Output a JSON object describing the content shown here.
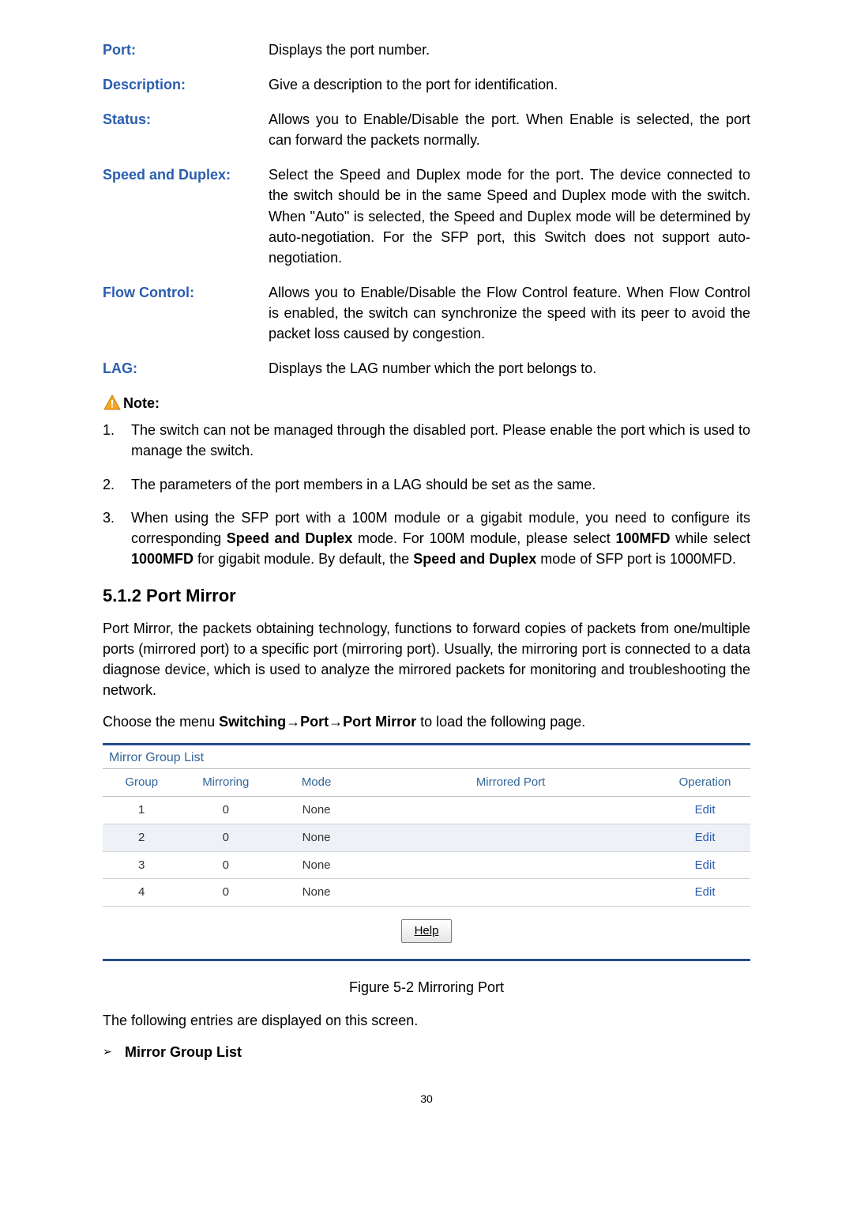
{
  "definitions": [
    {
      "term": "Port:",
      "desc": "Displays the port number."
    },
    {
      "term": "Description:",
      "desc": "Give a description to the port for identification."
    },
    {
      "term": "Status:",
      "desc": "Allows you to Enable/Disable the port. When Enable is selected, the port can forward the packets normally."
    },
    {
      "term": "Speed and Duplex:",
      "desc": "Select the Speed and Duplex mode for the port. The device connected to the switch should be in the same Speed and Duplex mode with the switch. When \"Auto\" is selected, the Speed and Duplex mode will be determined by auto-negotiation. For the SFP port, this Switch does not support auto-negotiation."
    },
    {
      "term": "Flow Control:",
      "desc": "Allows you to Enable/Disable the Flow Control feature. When Flow Control is enabled, the switch can synchronize the speed with its peer to avoid the packet loss caused by congestion."
    },
    {
      "term": "LAG:",
      "desc": "Displays the LAG number which the port belongs to."
    }
  ],
  "note_label": "Note:",
  "notes": [
    {
      "n": "1.",
      "t": "The switch can not be managed through the disabled port. Please enable the port which is used to manage the switch."
    },
    {
      "n": "2.",
      "t": "The parameters of the port members in a LAG should be set as the same."
    }
  ],
  "note3": {
    "n": "3.",
    "pre": "When using the SFP port with a 100M module or a gigabit module, you need to configure its corresponding ",
    "b1": "Speed and Duplex",
    "mid1": " mode. For 100M module, please select ",
    "b2": "100MFD",
    "mid2": " while select ",
    "b3": "1000MFD",
    "mid3": " for gigabit module. By default, the ",
    "b4": "Speed and Duplex",
    "post": " mode of SFP port is 1000MFD."
  },
  "h2": "5.1.2 Port Mirror",
  "intro": "Port Mirror, the packets obtaining technology, functions to forward copies of packets from one/multiple ports (mirrored port) to a specific port (mirroring port). Usually, the mirroring port is connected to a data diagnose device, which is used to analyze the mirrored packets for monitoring and troubleshooting the network.",
  "choose": {
    "pre": "Choose the menu ",
    "b": "Switching→Port→Port Mirror",
    "post": " to load the following page."
  },
  "table": {
    "title": "Mirror Group List",
    "headers": [
      "Group",
      "Mirroring",
      "Mode",
      "Mirrored Port",
      "Operation"
    ],
    "rows": [
      {
        "group": "1",
        "mirroring": "0",
        "mode": "None",
        "ports": "",
        "op": "Edit"
      },
      {
        "group": "2",
        "mirroring": "0",
        "mode": "None",
        "ports": "",
        "op": "Edit"
      },
      {
        "group": "3",
        "mirroring": "0",
        "mode": "None",
        "ports": "",
        "op": "Edit"
      },
      {
        "group": "4",
        "mirroring": "0",
        "mode": "None",
        "ports": "",
        "op": "Edit"
      }
    ],
    "help": "Help"
  },
  "fig_caption": "Figure 5-2 Mirroring Port",
  "after_fig": "The following entries are displayed on this screen.",
  "bullet": "Mirror Group List",
  "page_number": "30"
}
